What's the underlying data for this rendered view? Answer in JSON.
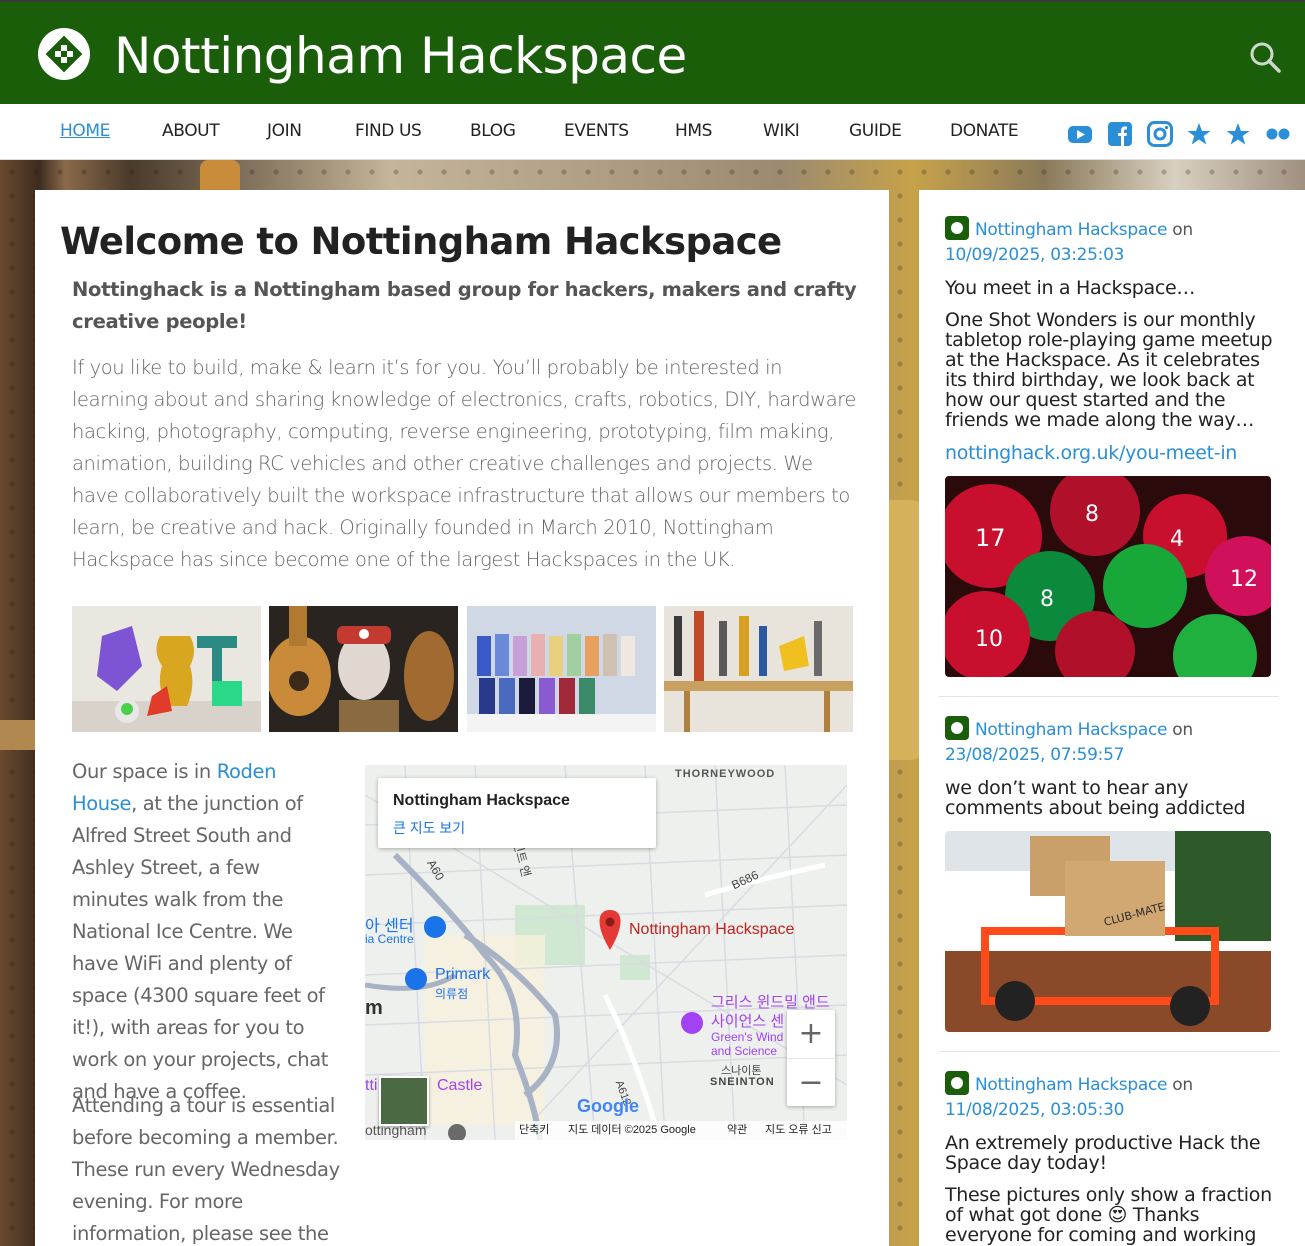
{
  "header": {
    "site_title": "Nottingham Hackspace",
    "brand_color": "#1a5e0a",
    "search_icon": "search-icon"
  },
  "nav": {
    "items": [
      {
        "label": "HOME",
        "active": true
      },
      {
        "label": "ABOUT"
      },
      {
        "label": "JOIN"
      },
      {
        "label": "FIND US"
      },
      {
        "label": "BLOG"
      },
      {
        "label": "EVENTS"
      },
      {
        "label": "HMS"
      },
      {
        "label": "WIKI"
      },
      {
        "label": "GUIDE"
      },
      {
        "label": "DONATE"
      }
    ],
    "social_icons": [
      "youtube-icon",
      "facebook-icon",
      "instagram-icon",
      "star-icon",
      "star-icon",
      "flickr-icon"
    ],
    "accent": "#2a8fd6"
  },
  "main": {
    "title": "Welcome to Nottingham Hackspace",
    "lead": "Nottinghack is a Nottingham based group for hackers, makers and crafty creative people!",
    "intro": "If you like to build, make & learn it’s for you. You’ll probably be interested in learning about and sharing knowledge of electronics, crafts, robotics, DIY, hardware hacking, photography, computing, reverse engineering, prototyping, film making, animation, building RC vehicles and other creative challenges and projects. We have collaboratively built the workspace infrastructure that allows our members to learn, be creative and hack. Originally founded in March 2010, Nottingham Hackspace has since become one of the largest Hackspaces in the UK.",
    "location_pre": "Our space is in ",
    "location_link": "Roden House",
    "location_post": ", at the junction of Alfred Street South and Ashley Street, a few minutes walk from the National Ice Centre. We have WiFi and plenty of space (4300 square feet of it!), with areas for you to work on your projects, chat and have a coffee.",
    "tour": "Attending a tour is essential before becoming a member. These run every Wednesday evening. For more information, please see the"
  },
  "map": {
    "card_title": "Nottingham Hackspace",
    "card_link": "큰 지도 보기",
    "pin_label": "Nottingham Hackspace",
    "labels": {
      "thorneywood": "THORNEYWOOD",
      "a60": "A60",
      "b686": "B686",
      "a612": "A612",
      "ice_centre_ko": "아 센터",
      "ice_centre_en": "ia Centre",
      "primark": "Primark",
      "primark_ko": "의류점",
      "greens_ko1": "그리스 윈드밀 앤드",
      "greens_ko2": "사이언스 센",
      "greens_en1": "Green's Wind",
      "greens_en2": "and Science",
      "sneinton_ko": "스나이톤",
      "sneinton": "SNEINTON",
      "castle": "Castle",
      "castle_pre": "tti",
      "nottingham": "ottingham",
      "m": "m",
      "road_ko": "세인트 앤",
      "google": "Google"
    },
    "zoom_in": "+",
    "zoom_out": "−",
    "attribution": {
      "shortcuts": "단축키",
      "data": "지도 데이터 ©2025 Google",
      "terms": "약관",
      "report": "지도 오류 신고"
    }
  },
  "sidebar": {
    "posts": [
      {
        "author": "Nottingham Hackspace",
        "on": "on",
        "date": "10/09/2025, 03:25:03",
        "title": "You meet in a Hackspace…",
        "body": "One Shot Wonders is our monthly tabletop role-playing game meetup at the Hackspace. As it celebrates its third birthday, we look back at how our quest started and the friends we made along the way…",
        "link": "nottinghack.org.uk/you-meet-in"
      },
      {
        "author": "Nottingham Hackspace",
        "on": "on",
        "date": "23/08/2025, 07:59:57",
        "body": "we don’t want to hear any comments about being addicted"
      },
      {
        "author": "Nottingham Hackspace",
        "on": "on",
        "date": "11/08/2025, 03:05:30",
        "title": "An extremely productive Hack the Space day today!",
        "body": "These pictures only show a fraction of what got done 😍 Thanks everyone for coming and working so"
      }
    ]
  }
}
